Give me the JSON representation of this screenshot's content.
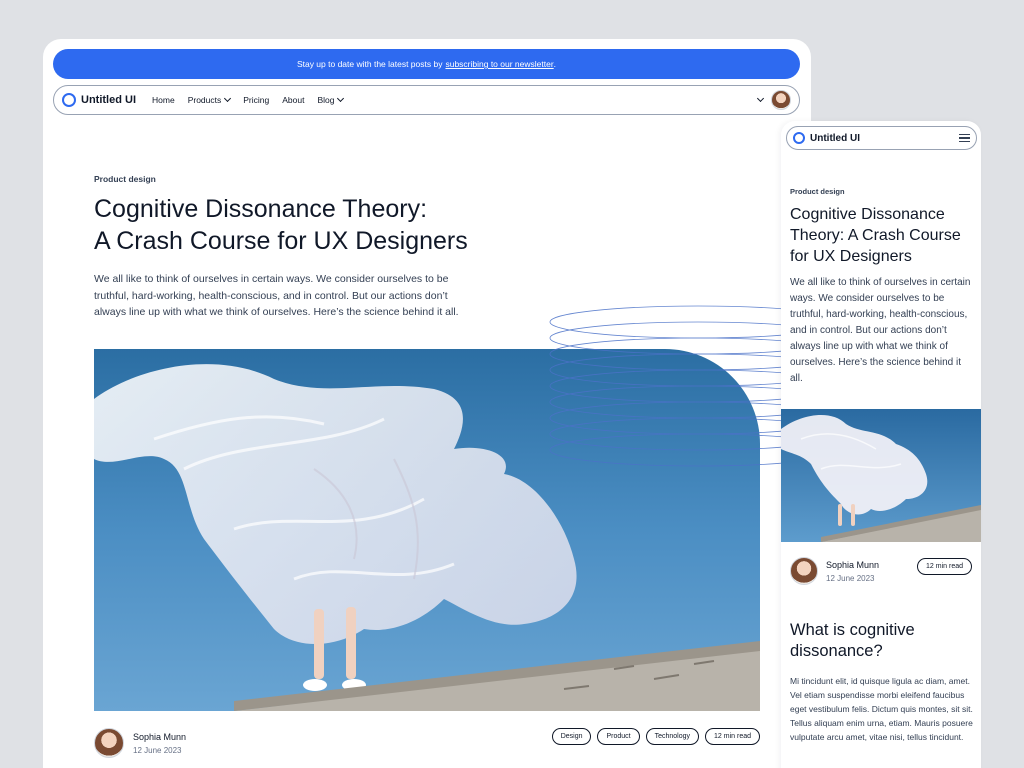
{
  "banner": {
    "text": "Stay up to date with the latest posts by",
    "link_text": "subscribing to our newsletter",
    "suffix": "."
  },
  "brand": {
    "name": "Untitled UI",
    "accent": "#2e6af0"
  },
  "nav": {
    "items": [
      {
        "label": "Home",
        "dropdown": false
      },
      {
        "label": "Products",
        "dropdown": true
      },
      {
        "label": "Pricing",
        "dropdown": false
      },
      {
        "label": "About",
        "dropdown": false
      },
      {
        "label": "Blog",
        "dropdown": true
      }
    ]
  },
  "article": {
    "category": "Product design",
    "title_line1": "Cognitive Dissonance Theory:",
    "title_line2": "A Crash Course for UX Designers",
    "mobile_title": "Cognitive Dissonance Theory: A Crash Course for UX Designers",
    "description": "We all like to think of ourselves in certain ways. We consider ourselves to be truthful, hard-working, health-conscious, and in control. But our actions don’t always line up with what we think of ourselves. Here’s the science behind it all.",
    "hero_image": "person-with-plastic-sheet-in-wind"
  },
  "author": {
    "name": "Sophia Munn",
    "date": "12 June 2023"
  },
  "tags": [
    "Design",
    "Product",
    "Technology",
    "12 min read"
  ],
  "mobile": {
    "read_time": "12 min read",
    "section_title": "What is cognitive dissonance?",
    "section_body": "Mi tincidunt elit, id quisque ligula ac diam, amet. Vel etiam suspendisse morbi eleifend faucibus eget vestibulum felis. Dictum quis montes, sit sit. Tellus aliquam enim urna, etiam. Mauris posuere vulputate arcu amet, vitae nisi, tellus tincidunt."
  },
  "icons": {
    "menu": "hamburger-icon",
    "account_chevron": "chevron-down-icon",
    "avatar": "avatar-image"
  }
}
